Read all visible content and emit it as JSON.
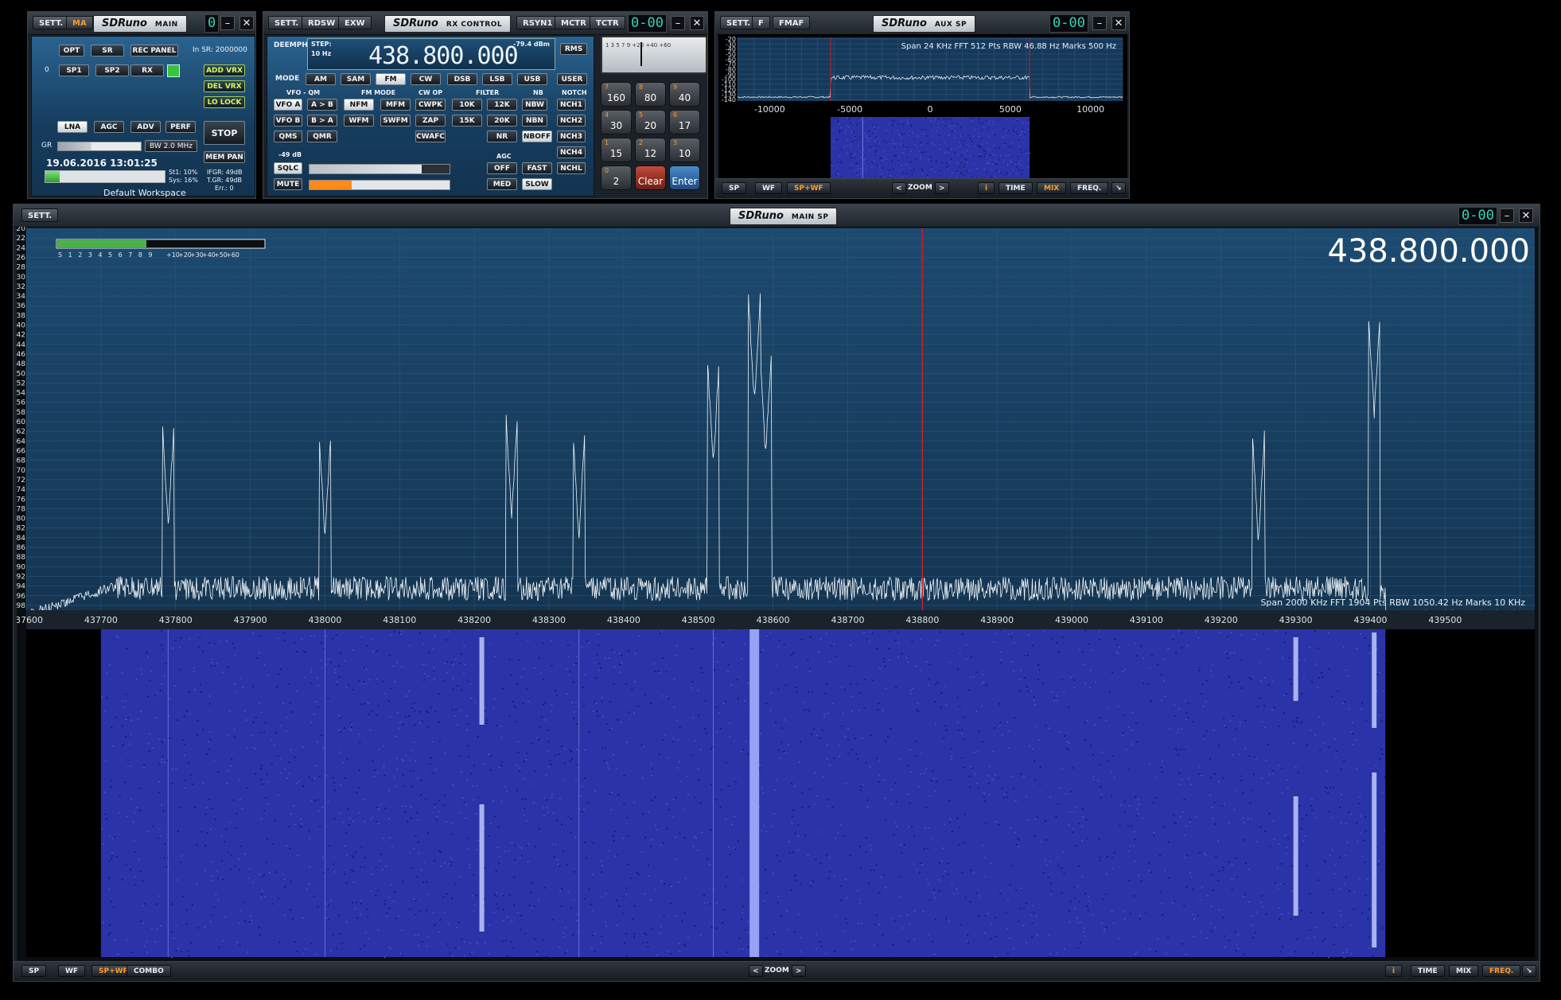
{
  "main_win": {
    "sett": "SETT.",
    "ma": "MA",
    "logo": "SDRuno",
    "logo_sub": "MAIN",
    "digit": "0",
    "buttons": {
      "opt": "OPT",
      "sr": "SR",
      "rec_panel": "REC PANEL",
      "sp1": "SP1",
      "sp2": "SP2",
      "rx": "RX",
      "add_vrx": "ADD VRX",
      "del_vrx": "DEL VRX",
      "lo_lock": "LO LOCK",
      "lna": "LNA",
      "agc": "AGC",
      "adv": "ADV",
      "perf": "PERF",
      "stop": "STOP",
      "mem_pan": "MEM PAN"
    },
    "in_sr": "In SR: 2000000",
    "zero": "0",
    "gr": "GR",
    "bw": "BW 2.0 MHz",
    "datetime": "19.06.2016 13:01:25",
    "st1": "St1: 10%",
    "sys": "Sys: 16%",
    "ifgr": "IFGR: 49dB",
    "tgr": "T.GR: 49dB",
    "err": "Err.: 0",
    "workspace": "Default Workspace"
  },
  "rx_win": {
    "sett": "SETT.",
    "rdsw": "RDSW",
    "exw": "EXW",
    "logo": "SDRuno",
    "logo_sub": "RX CONTROL",
    "rsyn1": "RSYN1",
    "mctr": "MCTR",
    "tctr": "TCTR",
    "digit": "0-00",
    "deemph": "DEEMPH",
    "step": "STEP:",
    "step_val": "10 Hz",
    "freq": "438.800.000",
    "dbm": "-79.4 dBm",
    "rms": "RMS",
    "labels": {
      "mode": "MODE",
      "vfo_qm": "VFO - QM",
      "fm_mode": "FM MODE",
      "cw_op": "CW OP",
      "filter": "FILTER",
      "nb": "NB",
      "notch": "NOTCH",
      "agc": "AGC",
      "db": "-49 dB"
    },
    "modes": [
      "AM",
      "SAM",
      "FM",
      "CW",
      "DSB",
      "LSB",
      "USB",
      "USER"
    ],
    "row1": {
      "vfo_a": "VFO A",
      "a_b": "A > B",
      "nfm": "NFM",
      "mfm": "MFM",
      "cwpk": "CWPK",
      "f10k": "10K",
      "f12k": "12K",
      "nbw": "NBW",
      "nch1": "NCH1"
    },
    "row2": {
      "vfo_b": "VFO B",
      "b_a": "B > A",
      "wfm": "WFM",
      "swfm": "SWFM",
      "zap": "ZAP",
      "f15k": "15K",
      "f20k": "20K",
      "nbn": "NBN",
      "nch2": "NCH2"
    },
    "row3": {
      "qms": "QMS",
      "qmr": "QMR",
      "cwafc": "CWAFC",
      "nr": "NR",
      "nboff": "NBOFF",
      "nch3": "NCH3"
    },
    "nch4": "NCH4",
    "nchl": "NCHL",
    "sqlc": "SQLC",
    "mute": "MUTE",
    "off": "OFF",
    "fast": "FAST",
    "med": "MED",
    "slow": "SLOW",
    "smeter_scale": "1 3 5 7 9 +20 +40 +60",
    "keys": [
      {
        "n": "7",
        "v": "160"
      },
      {
        "n": "8",
        "v": "80"
      },
      {
        "n": "9",
        "v": "40"
      },
      {
        "n": "4",
        "v": "30"
      },
      {
        "n": "5",
        "v": "20"
      },
      {
        "n": "6",
        "v": "17"
      },
      {
        "n": "1",
        "v": "15"
      },
      {
        "n": "2",
        "v": "12"
      },
      {
        "n": "3",
        "v": "10"
      },
      {
        "n": "0",
        "v": "2"
      },
      {
        "n": "",
        "v": "Clear"
      },
      {
        "n": "",
        "v": "Enter"
      }
    ]
  },
  "aux_win": {
    "sett": "SETT.",
    "f": "F",
    "fmaf": "FMAF",
    "logo": "SDRuno",
    "logo_sub": "AUX SP",
    "digit": "0-00",
    "info": "Span 24 KHz   FFT 512 Pts   RBW 46.88 Hz   Marks 500 Hz",
    "yticks": [
      "-20",
      "-30",
      "-40",
      "-50",
      "-60",
      "-70",
      "-80",
      "-90",
      "-100",
      "-110",
      "-120",
      "-130",
      "-140"
    ],
    "xticks": [
      "-10000",
      "-5000",
      "0",
      "5000",
      "10000"
    ],
    "bottom": {
      "sp": "SP",
      "wf": "WF",
      "spwf": "SP+WF",
      "lt": "<",
      "zoom": "ZOOM",
      "gt": ">",
      "i": "i",
      "time": "TIME",
      "mix": "MIX",
      "freq": "FREQ."
    }
  },
  "sp_win": {
    "sett": "SETT.",
    "logo": "SDRuno",
    "logo_sub": "MAIN SP",
    "digit": "0-00",
    "big_freq": "438.800.000",
    "smeter_scale": [
      "S",
      "1",
      "2",
      "3",
      "4",
      "5",
      "6",
      "7",
      "8",
      "9",
      "+10",
      "+20",
      "+30",
      "+40",
      "+50",
      "+60"
    ],
    "info": "Span 2000 KHz   FFT 1904 Pts   RBW 1050.42 Hz   Marks 10 KHz",
    "yticks": [
      "-20",
      "-22",
      "-24",
      "-26",
      "-28",
      "-30",
      "-32",
      "-34",
      "-36",
      "-38",
      "-40",
      "-42",
      "-44",
      "-46",
      "-48",
      "-50",
      "-52",
      "-54",
      "-56",
      "-58",
      "-60",
      "-62",
      "-64",
      "-66",
      "-68",
      "-70",
      "-72",
      "-74",
      "-76",
      "-78",
      "-80",
      "-82",
      "-84",
      "-86",
      "-88",
      "-90",
      "-92",
      "-94",
      "-96",
      "-98"
    ],
    "xticks": [
      "437600",
      "437700",
      "437800",
      "437900",
      "438000",
      "438100",
      "438200",
      "438300",
      "438400",
      "438500",
      "438600",
      "438700",
      "438800",
      "438900",
      "439000",
      "439100",
      "439200",
      "439300",
      "439400",
      "439500"
    ],
    "bottom": {
      "sp": "SP",
      "wf": "WF",
      "spwf": "SP+WF",
      "combo": "COMBO",
      "lt": "<",
      "zoom": "ZOOM",
      "gt": ">",
      "i": "i",
      "time": "TIME",
      "mix": "MIX",
      "freq": "FREQ."
    }
  },
  "colors": {
    "accent_orange": "#ff9a2a",
    "freq_cyan": "#37d5b6",
    "waterfall": "#2a33a8",
    "center_marker": "#c8202a"
  }
}
